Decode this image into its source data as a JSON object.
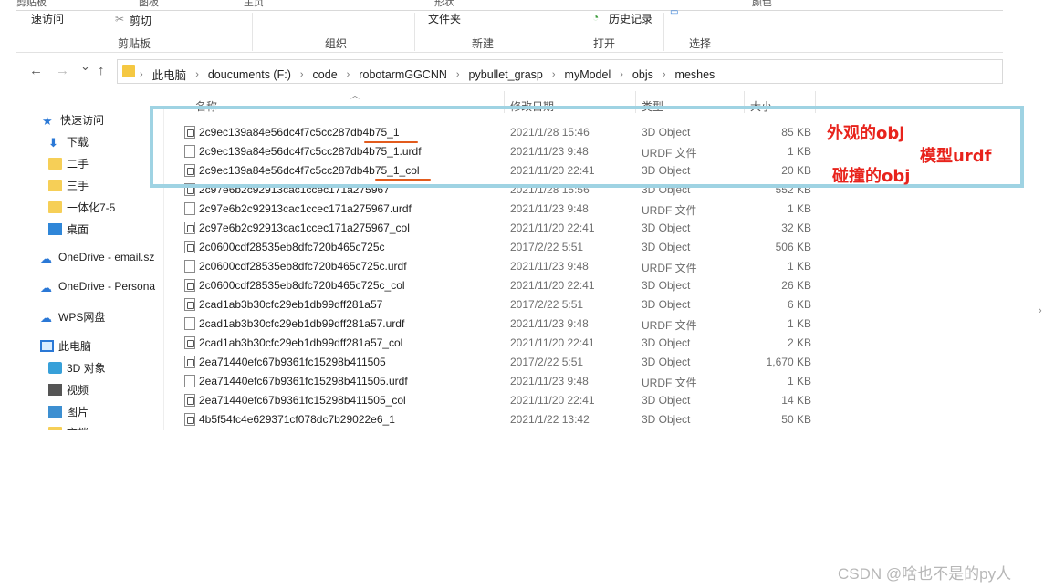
{
  "ribbon": {
    "top_partial": [
      "剪贴板",
      "图板",
      "主页",
      "形状",
      "颜色"
    ],
    "items": {
      "quick_access": "速访问",
      "cut": "剪切",
      "copy_path": "文件夹",
      "history": "历史记录"
    },
    "groups": [
      "剪贴板",
      "组织",
      "新建",
      "打开",
      "选择"
    ]
  },
  "nav": {
    "back": "←",
    "forward": "→",
    "recent": "⌄",
    "up": "↑"
  },
  "breadcrumb": [
    "此电脑",
    "doucuments (F:)",
    "code",
    "robotarmGGCNN",
    "pybullet_grasp",
    "myModel",
    "objs",
    "meshes"
  ],
  "sidebar": {
    "items": [
      {
        "label": "快速访问",
        "icon": "star-icon"
      },
      {
        "label": "下载",
        "icon": "download-icon"
      },
      {
        "label": "二手",
        "icon": "folder-icon"
      },
      {
        "label": "三手",
        "icon": "folder-icon"
      },
      {
        "label": "一体化7-5",
        "icon": "folder-icon"
      },
      {
        "label": "桌面",
        "icon": "desktop-icon"
      },
      {
        "label": "OneDrive - email.sz",
        "icon": "cloud-icon"
      },
      {
        "label": "OneDrive - Persona",
        "icon": "cloud-icon"
      },
      {
        "label": "WPS网盘",
        "icon": "cloud-icon"
      },
      {
        "label": "此电脑",
        "icon": "computer-icon"
      },
      {
        "label": "3D 对象",
        "icon": "cube-icon"
      },
      {
        "label": "视频",
        "icon": "video-icon"
      },
      {
        "label": "图片",
        "icon": "image-icon"
      },
      {
        "label": "文档",
        "icon": "document-icon"
      }
    ]
  },
  "columns": {
    "name": "名称",
    "date": "修改日期",
    "type": "类型",
    "size": "大小"
  },
  "files": [
    {
      "name": "2c9ec139a84e56dc4f7c5cc287db4b75_1",
      "date": "2021/1/28 15:46",
      "type": "3D Object",
      "size": "85 KB",
      "kind": "obj"
    },
    {
      "name": "2c9ec139a84e56dc4f7c5cc287db4b75_1.urdf",
      "date": "2021/11/23 9:48",
      "type": "URDF 文件",
      "size": "1 KB",
      "kind": "urdf"
    },
    {
      "name": "2c9ec139a84e56dc4f7c5cc287db4b75_1_col",
      "date": "2021/11/20 22:41",
      "type": "3D Object",
      "size": "20 KB",
      "kind": "obj"
    },
    {
      "name": "2c97e6b2c92913cac1ccec171a275967",
      "date": "2021/1/28 15:56",
      "type": "3D Object",
      "size": "552 KB",
      "kind": "obj"
    },
    {
      "name": "2c97e6b2c92913cac1ccec171a275967.urdf",
      "date": "2021/11/23 9:48",
      "type": "URDF 文件",
      "size": "1 KB",
      "kind": "urdf"
    },
    {
      "name": "2c97e6b2c92913cac1ccec171a275967_col",
      "date": "2021/11/20 22:41",
      "type": "3D Object",
      "size": "32 KB",
      "kind": "obj"
    },
    {
      "name": "2c0600cdf28535eb8dfc720b465c725c",
      "date": "2017/2/22 5:51",
      "type": "3D Object",
      "size": "506 KB",
      "kind": "obj"
    },
    {
      "name": "2c0600cdf28535eb8dfc720b465c725c.urdf",
      "date": "2021/11/23 9:48",
      "type": "URDF 文件",
      "size": "1 KB",
      "kind": "urdf"
    },
    {
      "name": "2c0600cdf28535eb8dfc720b465c725c_col",
      "date": "2021/11/20 22:41",
      "type": "3D Object",
      "size": "26 KB",
      "kind": "obj"
    },
    {
      "name": "2cad1ab3b30cfc29eb1db99dff281a57",
      "date": "2017/2/22 5:51",
      "type": "3D Object",
      "size": "6 KB",
      "kind": "obj"
    },
    {
      "name": "2cad1ab3b30cfc29eb1db99dff281a57.urdf",
      "date": "2021/11/23 9:48",
      "type": "URDF 文件",
      "size": "1 KB",
      "kind": "urdf"
    },
    {
      "name": "2cad1ab3b30cfc29eb1db99dff281a57_col",
      "date": "2021/11/20 22:41",
      "type": "3D Object",
      "size": "2 KB",
      "kind": "obj"
    },
    {
      "name": "2ea71440efc67b9361fc15298b411505",
      "date": "2017/2/22 5:51",
      "type": "3D Object",
      "size": "1,670 KB",
      "kind": "obj"
    },
    {
      "name": "2ea71440efc67b9361fc15298b411505.urdf",
      "date": "2021/11/23 9:48",
      "type": "URDF 文件",
      "size": "1 KB",
      "kind": "urdf"
    },
    {
      "name": "2ea71440efc67b9361fc15298b411505_col",
      "date": "2021/11/20 22:41",
      "type": "3D Object",
      "size": "14 KB",
      "kind": "obj"
    },
    {
      "name": "4b5f54fc4e629371cf078dc7b29022e6_1",
      "date": "2021/1/22 13:42",
      "type": "3D Object",
      "size": "50 KB",
      "kind": "obj"
    }
  ],
  "annotations": {
    "appearance_obj": "外观的obj",
    "model_urdf": "模型urdf",
    "collision_obj": "碰撞的obj",
    "highlight_color": "#9fd3e3",
    "text_color": "#e8231c",
    "underline_color": "#e25b1d"
  },
  "watermark": "CSDN @啥也不是的py人"
}
